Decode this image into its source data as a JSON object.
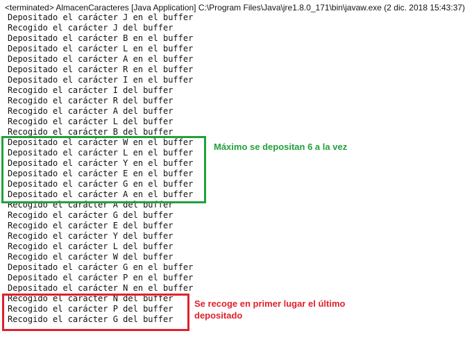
{
  "console": {
    "header": "<terminated> AlmacenCaracteres [Java Application] C:\\Program Files\\Java\\jre1.8.0_171\\bin\\javaw.exe (2 dic. 2018 15:43:37)",
    "lines": [
      "Depositado el carácter J en el buffer",
      "Recogido el carácter J del buffer",
      "Depositado el carácter B en el buffer",
      "Depositado el carácter L en el buffer",
      "Depositado el carácter A en el buffer",
      "Depositado el carácter R en el buffer",
      "Depositado el carácter I en el buffer",
      "Recogido el carácter I del buffer",
      "Recogido el carácter R del buffer",
      "Recogido el carácter A del buffer",
      "Recogido el carácter L del buffer",
      "Recogido el carácter B del buffer",
      "Depositado el carácter W en el buffer",
      "Depositado el carácter L en el buffer",
      "Depositado el carácter Y en el buffer",
      "Depositado el carácter E en el buffer",
      "Depositado el carácter G en el buffer",
      "Depositado el carácter A en el buffer",
      "Recogido el carácter A del buffer",
      "Recogido el carácter G del buffer",
      "Recogido el carácter E del buffer",
      "Recogido el carácter Y del buffer",
      "Recogido el carácter L del buffer",
      "Recogido el carácter W del buffer",
      "Depositado el carácter G en el buffer",
      "Depositado el carácter P en el buffer",
      "Depositado el carácter N en el buffer",
      "Recogido el carácter N del buffer",
      "Recogido el carácter P del buffer",
      "Recogido el carácter G del buffer"
    ]
  },
  "annotations": {
    "green_text": "Máximo se depositan 6 a la vez",
    "red_text_line1": "Se recoge en primer lugar el último",
    "red_text_line2": "depositado",
    "green_color": "#22a03a",
    "red_color": "#e0202a"
  }
}
